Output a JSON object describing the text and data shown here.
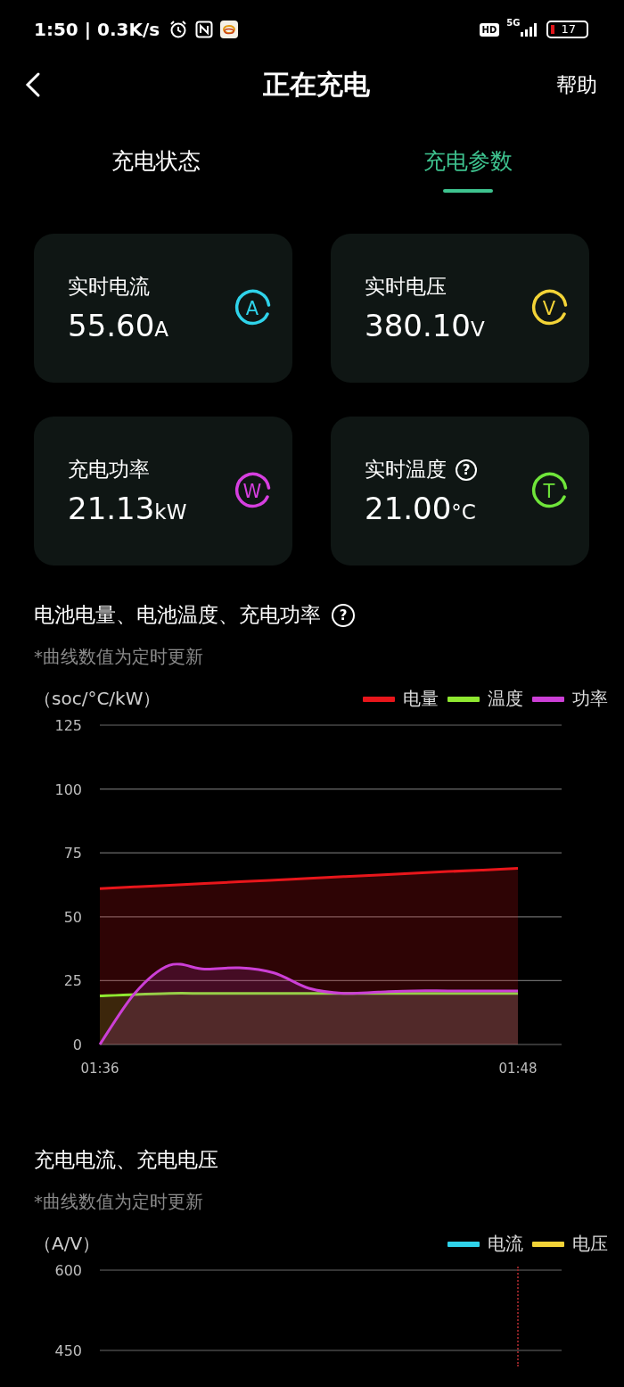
{
  "status_bar": {
    "time_speed": "1:50 | 0.3K/s",
    "hd": "HD",
    "network": "5G",
    "battery": "17"
  },
  "header": {
    "title": "正在充电",
    "help": "帮助"
  },
  "tabs": [
    {
      "label": "充电状态",
      "selected": false
    },
    {
      "label": "充电参数",
      "selected": true
    }
  ],
  "metrics": [
    {
      "label": "实时电流",
      "value": "55.60",
      "unit": "A",
      "letter": "A",
      "color": "#2fd3ea"
    },
    {
      "label": "实时电压",
      "value": "380.10",
      "unit": "V",
      "letter": "V",
      "color": "#f2d337"
    },
    {
      "label": "充电功率",
      "value": "21.13",
      "unit": "kW",
      "letter": "W",
      "color": "#d63fe0"
    },
    {
      "label": "实时温度",
      "help": "?",
      "value": "21.00",
      "unit": "°C",
      "letter": "T",
      "color": "#6fe53a"
    }
  ],
  "sections": [
    {
      "title": "电池电量、电池温度、充电功率",
      "help": "?",
      "note": "*曲线数值为定时更新",
      "chart_data": {
        "type": "area",
        "ylabel": "（soc/°C/kW）",
        "categories": [
          "01:36",
          null,
          null,
          null,
          null,
          null,
          null,
          null,
          null,
          null,
          null,
          null,
          "01:48"
        ],
        "ylim": [
          0,
          125
        ],
        "grid": true,
        "yticks": [
          0,
          25,
          50,
          75,
          100,
          125
        ],
        "series": [
          {
            "name": "电量",
            "color": "#e8161b",
            "values": [
              61,
              61.7,
              62.3,
              63,
              63.7,
              64.3,
              65,
              65.7,
              66.3,
              67,
              67.7,
              68.3,
              69
            ]
          },
          {
            "name": "温度",
            "color": "#8fe830",
            "values": [
              19,
              19.6,
              20,
              20,
              20,
              20,
              20,
              20,
              20,
              20,
              20,
              20,
              20
            ]
          },
          {
            "name": "功率",
            "color": "#cc3fd6",
            "values": [
              0,
              20,
              31,
              29.5,
              30,
              28,
              22,
              20,
              20.5,
              21,
              21,
              21,
              21
            ]
          }
        ]
      }
    },
    {
      "title": "充电电流、充电电压",
      "note": "*曲线数值为定时更新",
      "chart_data": {
        "type": "line",
        "ylabel": "（A/V）",
        "ylim": [
          450,
          600
        ],
        "yticks": [
          600,
          450
        ],
        "series": [
          {
            "name": "电流",
            "color": "#2fd3ea"
          },
          {
            "name": "电压",
            "color": "#f2d337"
          }
        ]
      }
    }
  ]
}
